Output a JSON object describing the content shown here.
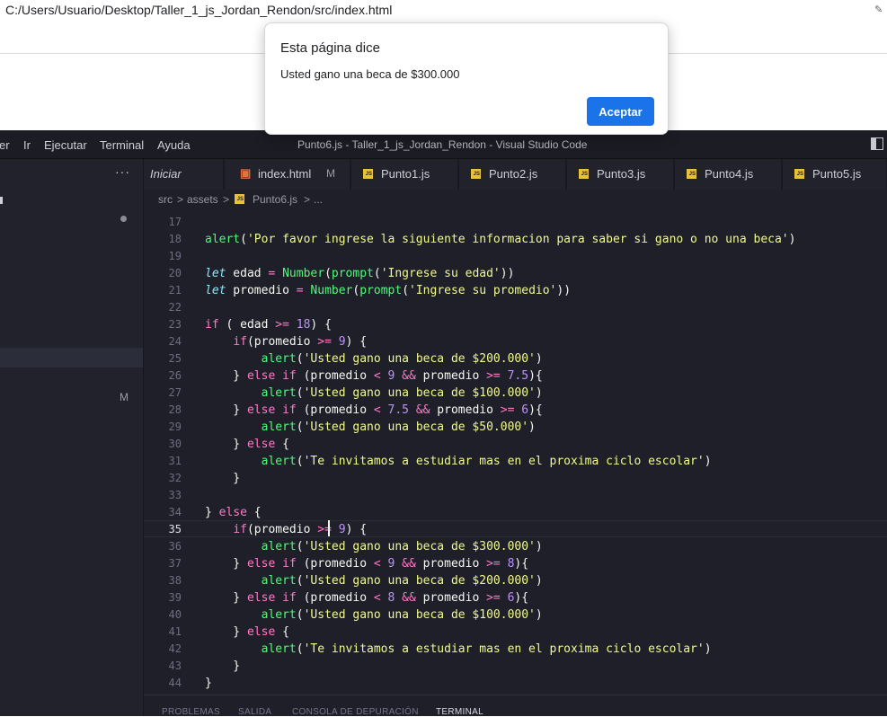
{
  "browser": {
    "url": "C:/Users/Usuario/Desktop/Taller_1_js_Jordan_Rendon/src/index.html"
  },
  "alert": {
    "title": "Esta página dice",
    "message": "Usted gano una beca de $300.000",
    "ok_label": "Aceptar"
  },
  "vscode": {
    "menu": [
      "er",
      "Ir",
      "Ejecutar",
      "Terminal",
      "Ayuda"
    ],
    "window_title": "Punto6.js - Taller_1_js_Jordan_Rendon - Visual Studio Code",
    "sidebar_more": "···",
    "sidebar_badge": "M",
    "tabs": [
      {
        "label": "Iniciar",
        "icon": "none"
      },
      {
        "label": "index.html",
        "icon": "html5-icon",
        "badge": "M"
      },
      {
        "label": "Punto1.js",
        "icon": "js-icon"
      },
      {
        "label": "Punto2.js",
        "icon": "js-icon"
      },
      {
        "label": "Punto3.js",
        "icon": "js-icon"
      },
      {
        "label": "Punto4.js",
        "icon": "js-icon"
      },
      {
        "label": "Punto5.js",
        "icon": "js-icon"
      }
    ],
    "breadcrumbs": [
      "src",
      ">",
      "assets",
      ">",
      "Punto6.js",
      ">",
      "..."
    ],
    "current_line": 35,
    "panel_tabs": [
      "PROBLEMAS",
      "SALIDA",
      "CONSOLA DE DEPURACIÓN",
      "TERMINAL"
    ],
    "colors": {
      "keyword": "#ff79c6",
      "function": "#50fa7b",
      "string": "#f1fa8c",
      "number": "#bd93f9",
      "storage": "#8be9fd",
      "text": "#f8f8f2"
    }
  },
  "code": [
    {
      "n": 17,
      "tokens": []
    },
    {
      "n": 18,
      "tokens": [
        {
          "t": "alert",
          "c": "fn"
        },
        {
          "t": "(",
          "c": "p"
        },
        {
          "t": "'Por favor ingrese la siguiente informacion para saber si gano o no una beca'",
          "c": "s"
        },
        {
          "t": ")",
          "c": "p"
        }
      ]
    },
    {
      "n": 19,
      "tokens": []
    },
    {
      "n": 20,
      "tokens": [
        {
          "t": "let",
          "c": "st"
        },
        {
          "t": " edad ",
          "c": "v"
        },
        {
          "t": "=",
          "c": "kw"
        },
        {
          "t": " ",
          "c": "v"
        },
        {
          "t": "Number",
          "c": "fn"
        },
        {
          "t": "(",
          "c": "p"
        },
        {
          "t": "prompt",
          "c": "fn"
        },
        {
          "t": "(",
          "c": "p"
        },
        {
          "t": "'Ingrese su edad'",
          "c": "s"
        },
        {
          "t": "))",
          "c": "p"
        }
      ]
    },
    {
      "n": 21,
      "tokens": [
        {
          "t": "let",
          "c": "st"
        },
        {
          "t": " promedio ",
          "c": "v"
        },
        {
          "t": "=",
          "c": "kw"
        },
        {
          "t": " ",
          "c": "v"
        },
        {
          "t": "Number",
          "c": "fn"
        },
        {
          "t": "(",
          "c": "p"
        },
        {
          "t": "prompt",
          "c": "fn"
        },
        {
          "t": "(",
          "c": "p"
        },
        {
          "t": "'Ingrese su promedio'",
          "c": "s"
        },
        {
          "t": "))",
          "c": "p"
        }
      ]
    },
    {
      "n": 22,
      "tokens": []
    },
    {
      "n": 23,
      "tokens": [
        {
          "t": "if",
          "c": "kw"
        },
        {
          "t": " ( edad ",
          "c": "v"
        },
        {
          "t": ">=",
          "c": "kw"
        },
        {
          "t": " ",
          "c": "v"
        },
        {
          "t": "18",
          "c": "num"
        },
        {
          "t": ") {",
          "c": "p"
        }
      ]
    },
    {
      "n": 24,
      "tokens": [
        {
          "t": "    ",
          "c": "v"
        },
        {
          "t": "if",
          "c": "kw"
        },
        {
          "t": "(promedio ",
          "c": "v"
        },
        {
          "t": ">=",
          "c": "kw"
        },
        {
          "t": " ",
          "c": "v"
        },
        {
          "t": "9",
          "c": "num"
        },
        {
          "t": ") {",
          "c": "p"
        }
      ]
    },
    {
      "n": 25,
      "tokens": [
        {
          "t": "        ",
          "c": "v"
        },
        {
          "t": "alert",
          "c": "fn"
        },
        {
          "t": "(",
          "c": "p"
        },
        {
          "t": "'Usted gano una beca de $200.000'",
          "c": "s"
        },
        {
          "t": ")",
          "c": "p"
        }
      ]
    },
    {
      "n": 26,
      "tokens": [
        {
          "t": "    } ",
          "c": "p"
        },
        {
          "t": "else if",
          "c": "kw"
        },
        {
          "t": " (promedio ",
          "c": "v"
        },
        {
          "t": "<",
          "c": "kw"
        },
        {
          "t": " ",
          "c": "v"
        },
        {
          "t": "9",
          "c": "num"
        },
        {
          "t": " ",
          "c": "v"
        },
        {
          "t": "&&",
          "c": "kw"
        },
        {
          "t": " promedio ",
          "c": "v"
        },
        {
          "t": ">=",
          "c": "kw"
        },
        {
          "t": " ",
          "c": "v"
        },
        {
          "t": "7.5",
          "c": "num"
        },
        {
          "t": "){",
          "c": "p"
        }
      ]
    },
    {
      "n": 27,
      "tokens": [
        {
          "t": "        ",
          "c": "v"
        },
        {
          "t": "alert",
          "c": "fn"
        },
        {
          "t": "(",
          "c": "p"
        },
        {
          "t": "'Usted gano una beca de $100.000'",
          "c": "s"
        },
        {
          "t": ")",
          "c": "p"
        }
      ]
    },
    {
      "n": 28,
      "tokens": [
        {
          "t": "    } ",
          "c": "p"
        },
        {
          "t": "else if",
          "c": "kw"
        },
        {
          "t": " (promedio ",
          "c": "v"
        },
        {
          "t": "<",
          "c": "kw"
        },
        {
          "t": " ",
          "c": "v"
        },
        {
          "t": "7.5",
          "c": "num"
        },
        {
          "t": " ",
          "c": "v"
        },
        {
          "t": "&&",
          "c": "kw"
        },
        {
          "t": " promedio ",
          "c": "v"
        },
        {
          "t": ">=",
          "c": "kw"
        },
        {
          "t": " ",
          "c": "v"
        },
        {
          "t": "6",
          "c": "num"
        },
        {
          "t": "){",
          "c": "p"
        }
      ]
    },
    {
      "n": 29,
      "tokens": [
        {
          "t": "        ",
          "c": "v"
        },
        {
          "t": "alert",
          "c": "fn"
        },
        {
          "t": "(",
          "c": "p"
        },
        {
          "t": "'Usted gano una beca de $50.000'",
          "c": "s"
        },
        {
          "t": ")",
          "c": "p"
        }
      ]
    },
    {
      "n": 30,
      "tokens": [
        {
          "t": "    } ",
          "c": "p"
        },
        {
          "t": "else",
          "c": "kw"
        },
        {
          "t": " {",
          "c": "p"
        }
      ]
    },
    {
      "n": 31,
      "tokens": [
        {
          "t": "        ",
          "c": "v"
        },
        {
          "t": "alert",
          "c": "fn"
        },
        {
          "t": "(",
          "c": "p"
        },
        {
          "t": "'Te invitamos a estudiar mas en el proxima ciclo escolar'",
          "c": "s"
        },
        {
          "t": ")",
          "c": "p"
        }
      ]
    },
    {
      "n": 32,
      "tokens": [
        {
          "t": "    }",
          "c": "p"
        }
      ]
    },
    {
      "n": 33,
      "tokens": []
    },
    {
      "n": 34,
      "tokens": [
        {
          "t": "} ",
          "c": "p"
        },
        {
          "t": "else",
          "c": "kw"
        },
        {
          "t": " {",
          "c": "p"
        }
      ]
    },
    {
      "n": 35,
      "tokens": [
        {
          "t": "    ",
          "c": "v"
        },
        {
          "t": "if",
          "c": "kw"
        },
        {
          "t": "(promedio ",
          "c": "v"
        },
        {
          "t": ">=",
          "c": "kw"
        },
        {
          "t": " ",
          "c": "v"
        },
        {
          "t": "9",
          "c": "num"
        },
        {
          "t": ") {",
          "c": "p"
        }
      ]
    },
    {
      "n": 36,
      "tokens": [
        {
          "t": "        ",
          "c": "v"
        },
        {
          "t": "alert",
          "c": "fn"
        },
        {
          "t": "(",
          "c": "p"
        },
        {
          "t": "'Usted gano una beca de $300.000'",
          "c": "s"
        },
        {
          "t": ")",
          "c": "p"
        }
      ]
    },
    {
      "n": 37,
      "tokens": [
        {
          "t": "    } ",
          "c": "p"
        },
        {
          "t": "else if",
          "c": "kw"
        },
        {
          "t": " (promedio ",
          "c": "v"
        },
        {
          "t": "<",
          "c": "kw"
        },
        {
          "t": " ",
          "c": "v"
        },
        {
          "t": "9",
          "c": "num"
        },
        {
          "t": " ",
          "c": "v"
        },
        {
          "t": "&&",
          "c": "kw"
        },
        {
          "t": " promedio ",
          "c": "v"
        },
        {
          "t": ">=",
          "c": "kw"
        },
        {
          "t": " ",
          "c": "v"
        },
        {
          "t": "8",
          "c": "num"
        },
        {
          "t": "){",
          "c": "p"
        }
      ]
    },
    {
      "n": 38,
      "tokens": [
        {
          "t": "        ",
          "c": "v"
        },
        {
          "t": "alert",
          "c": "fn"
        },
        {
          "t": "(",
          "c": "p"
        },
        {
          "t": "'Usted gano una beca de $200.000'",
          "c": "s"
        },
        {
          "t": ")",
          "c": "p"
        }
      ]
    },
    {
      "n": 39,
      "tokens": [
        {
          "t": "    } ",
          "c": "p"
        },
        {
          "t": "else if",
          "c": "kw"
        },
        {
          "t": " (promedio ",
          "c": "v"
        },
        {
          "t": "<",
          "c": "kw"
        },
        {
          "t": " ",
          "c": "v"
        },
        {
          "t": "8",
          "c": "num"
        },
        {
          "t": " ",
          "c": "v"
        },
        {
          "t": "&&",
          "c": "kw"
        },
        {
          "t": " promedio ",
          "c": "v"
        },
        {
          "t": ">=",
          "c": "kw"
        },
        {
          "t": " ",
          "c": "v"
        },
        {
          "t": "6",
          "c": "num"
        },
        {
          "t": "){",
          "c": "p"
        }
      ]
    },
    {
      "n": 40,
      "tokens": [
        {
          "t": "        ",
          "c": "v"
        },
        {
          "t": "alert",
          "c": "fn"
        },
        {
          "t": "(",
          "c": "p"
        },
        {
          "t": "'Usted gano una beca de $100.000'",
          "c": "s"
        },
        {
          "t": ")",
          "c": "p"
        }
      ]
    },
    {
      "n": 41,
      "tokens": [
        {
          "t": "    } ",
          "c": "p"
        },
        {
          "t": "else",
          "c": "kw"
        },
        {
          "t": " {",
          "c": "p"
        }
      ]
    },
    {
      "n": 42,
      "tokens": [
        {
          "t": "        ",
          "c": "v"
        },
        {
          "t": "alert",
          "c": "fn"
        },
        {
          "t": "(",
          "c": "p"
        },
        {
          "t": "'Te invitamos a estudiar mas en el proxima ciclo escolar'",
          "c": "s"
        },
        {
          "t": ")",
          "c": "p"
        }
      ]
    },
    {
      "n": 43,
      "tokens": [
        {
          "t": "    }",
          "c": "p"
        }
      ]
    },
    {
      "n": 44,
      "tokens": [
        {
          "t": "}",
          "c": "p"
        }
      ]
    }
  ]
}
